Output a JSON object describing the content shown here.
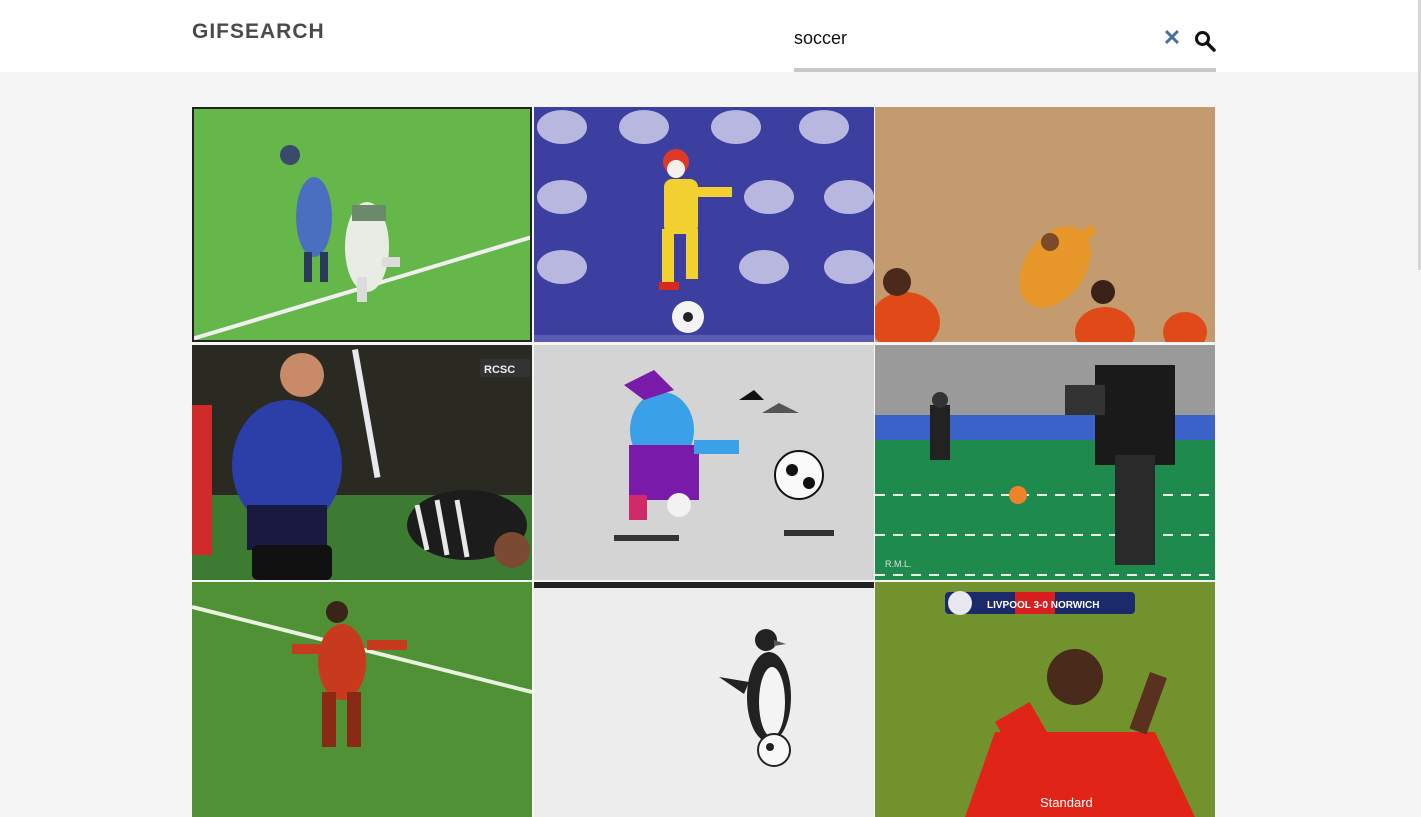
{
  "header": {
    "logo": "GIFSEARCH"
  },
  "search": {
    "value": "soccer",
    "clear_icon": "close-icon",
    "submit_icon": "search-icon"
  },
  "results": [
    {
      "scene": "two players colliding on green pitch"
    },
    {
      "scene": "clown juggling soccer ball on purple polka-dot stage"
    },
    {
      "scene": "player diving on sand field"
    },
    {
      "scene": "trainer spraying injured player"
    },
    {
      "scene": "cartoon character kicking ball"
    },
    {
      "scene": "robots playing soccer"
    },
    {
      "scene": "player running on pitch"
    },
    {
      "scene": "penguin with ball in snow"
    },
    {
      "scene": "player celebrating in red kit"
    }
  ],
  "overlay_texts": {
    "scoreboard_team": "RCSC",
    "robot_logo": "R.M.L.",
    "match_score": "LIVPOOL 3-0 NORWICH",
    "kit_sponsor": "Standard"
  },
  "colors": {
    "background": "#f4f5f4",
    "header": "#ffffff",
    "accent_clear": "#4a6fa5",
    "underline": "#c8c8c8"
  }
}
